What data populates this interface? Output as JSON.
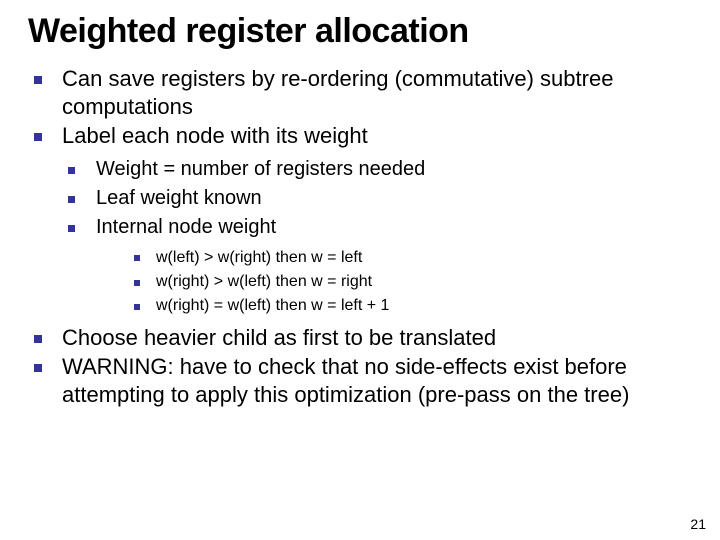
{
  "title": "Weighted register allocation",
  "bullets": {
    "b1": "Can save registers by re-ordering (commutative) subtree computations",
    "b2": "Label each node with its weight",
    "b2_1": "Weight = number of registers needed",
    "b2_2": "Leaf weight known",
    "b2_3": "Internal node weight",
    "b2_3_1": "w(left) > w(right) then w  = left",
    "b2_3_2": "w(right) > w(left) then w  = right",
    "b2_3_3": "w(right) = w(left) then w  = left + 1",
    "b3": "Choose heavier child as first to be translated",
    "b4": "WARNING: have to check that no side-effects exist before attempting to apply this optimization (pre-pass on the tree)"
  },
  "page_number": "21"
}
